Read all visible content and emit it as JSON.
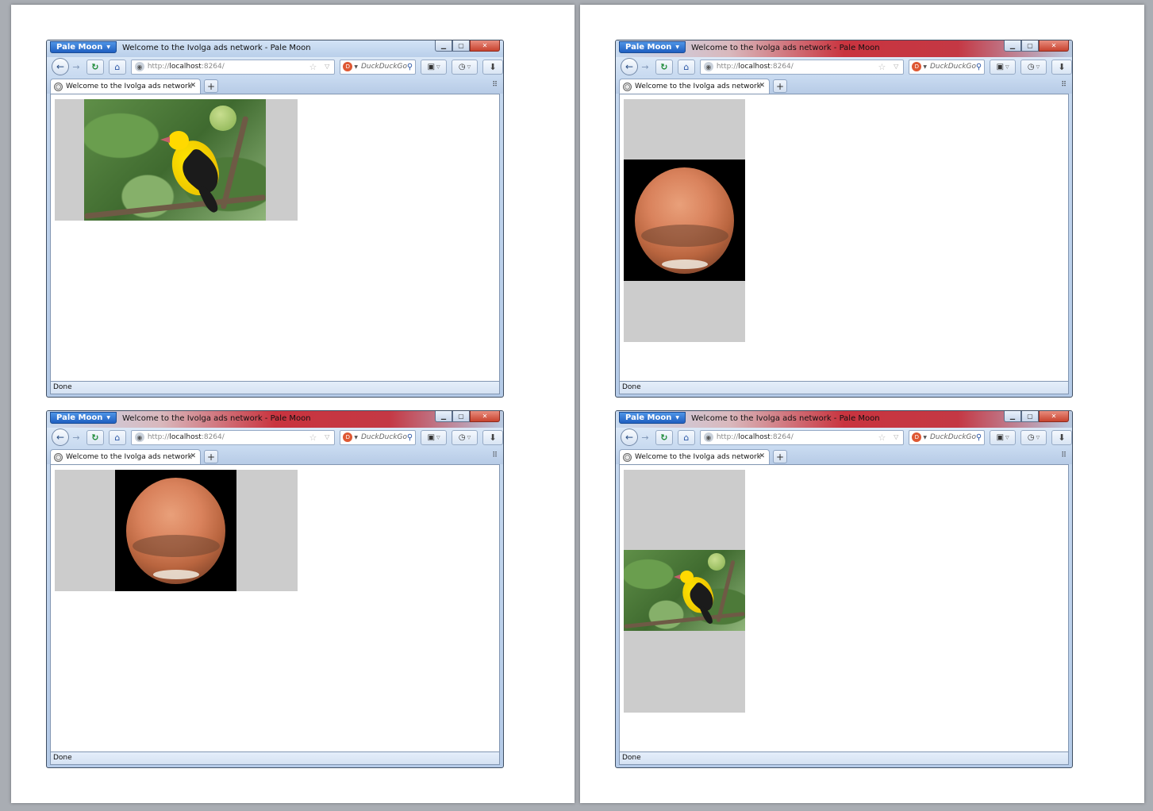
{
  "browser": {
    "app_button_label": "Pale Moon",
    "window_title": "Welcome to the Ivolga ads network - Pale Moon",
    "url_scheme": "http://",
    "url_host": "localhost",
    "url_rest": ":8264/",
    "search_placeholder": "DuckDuckGo",
    "tab_title": "Welcome to the Ivolga ads network",
    "status_text": "Done"
  },
  "windows": [
    {
      "id": "top-left",
      "ad_orientation": "landscape",
      "image": "golden-oriole-bird"
    },
    {
      "id": "top-right",
      "ad_orientation": "portrait",
      "image": "mars-planet"
    },
    {
      "id": "bottom-left",
      "ad_orientation": "landscape",
      "image": "mars-planet"
    },
    {
      "id": "bottom-right",
      "ad_orientation": "portrait",
      "image": "golden-oriole-bird"
    }
  ],
  "icons": {
    "back": "back-arrow-icon",
    "forward": "forward-arrow-icon",
    "reload": "reload-icon",
    "home": "home-icon",
    "bookmark": "star-icon",
    "search_engine": "duckduckgo-icon",
    "search": "magnifier-icon",
    "bookmarks_menu": "bookmarks-icon",
    "history": "clock-icon",
    "downloads": "download-icon",
    "tab_favicon": "globe-icon",
    "tab_close": "close-icon",
    "new_tab": "plus-icon",
    "tab_list": "grip-icon"
  },
  "colors": {
    "ad_background": "#cccccc",
    "app_button": "#2f73d4",
    "close_button": "#c8432f",
    "active_title_red": "#c9343f"
  }
}
